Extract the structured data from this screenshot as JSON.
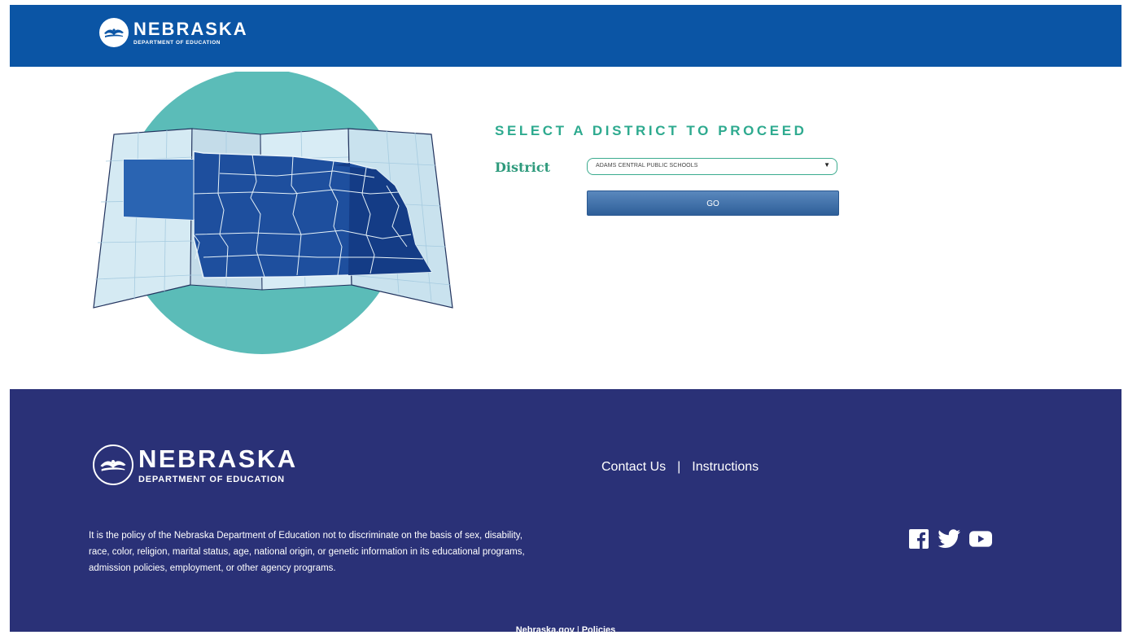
{
  "header": {
    "brand_name": "NEBRASKA",
    "brand_sub": "DEPARTMENT OF EDUCATION"
  },
  "main": {
    "title": "SELECT A DISTRICT TO PROCEED",
    "district_label": "District",
    "district_selected": "ADAMS CENTRAL PUBLIC SCHOOLS",
    "go_label": "GO"
  },
  "footer": {
    "brand_name": "NEBRASKA",
    "brand_sub": "DEPARTMENT OF EDUCATION",
    "links": [
      "Contact Us",
      "Instructions"
    ],
    "separator": "|",
    "policy_text": "It is the policy of the Nebraska Department of Education not to discriminate on the basis of sex, disability, race, color, religion, marital status, age, national origin, or genetic information in its educational programs, admission policies, employment, or other agency programs.",
    "social_icons": [
      "facebook-icon",
      "twitter-icon",
      "youtube-icon"
    ],
    "bottom_links": [
      "Nebraska.gov",
      "Policies"
    ],
    "bottom_divider": "|"
  },
  "colors": {
    "header_bg": "#0b55a5",
    "footer_bg": "#2a3177",
    "accent": "#2eaa8f",
    "button": "#3a6ba6",
    "map_circle": "#5bbcb8"
  }
}
